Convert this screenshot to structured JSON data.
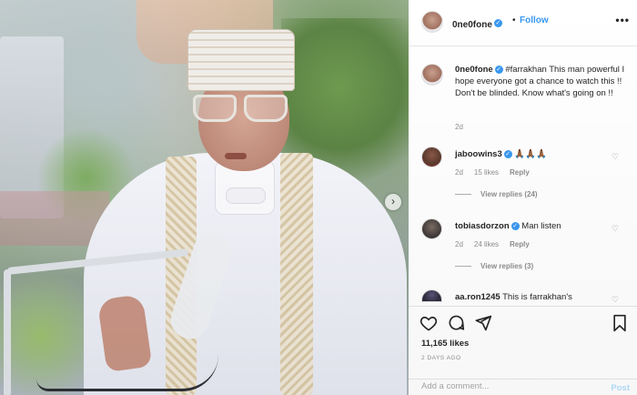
{
  "post": {
    "username": "0ne0fone",
    "follow_label": "Follow",
    "separator": "•",
    "more_label": "•••",
    "next_arrow": "›",
    "caption": {
      "username": "0ne0fone",
      "text": "#farrakhan This man powerful I hope everyone got a chance to watch this !! Don't be blinded. Know what's going on !!",
      "time": "2d"
    },
    "comments": [
      {
        "username": "jaboowins3",
        "text": "🙏🏾🙏🏾🙏🏾",
        "time": "2d",
        "likes": "15 likes",
        "reply": "Reply",
        "view_replies": "View replies (24)"
      },
      {
        "username": "tobiasdorzon",
        "text": "Man listen",
        "time": "2d",
        "likes": "24 likes",
        "reply": "Reply",
        "view_replies": "View replies (3)"
      },
      {
        "username": "aa.ron1245",
        "text": "This is farrakhan's"
      }
    ],
    "likes_count": "11,165 likes",
    "posted_date": "2 DAYS AGO",
    "add_comment_placeholder": "Add a comment...",
    "post_button": "Post"
  },
  "colors": {
    "link_blue": "#3897f0",
    "verified_blue": "#3897f0",
    "muted_text": "#8e8e8e",
    "post_button_disabled": "#b2dffc"
  },
  "icons": {
    "like": "heart-outline-icon",
    "comment": "speech-bubble-icon",
    "share": "paper-plane-icon",
    "save": "bookmark-icon",
    "verified": "verified-badge-icon"
  }
}
